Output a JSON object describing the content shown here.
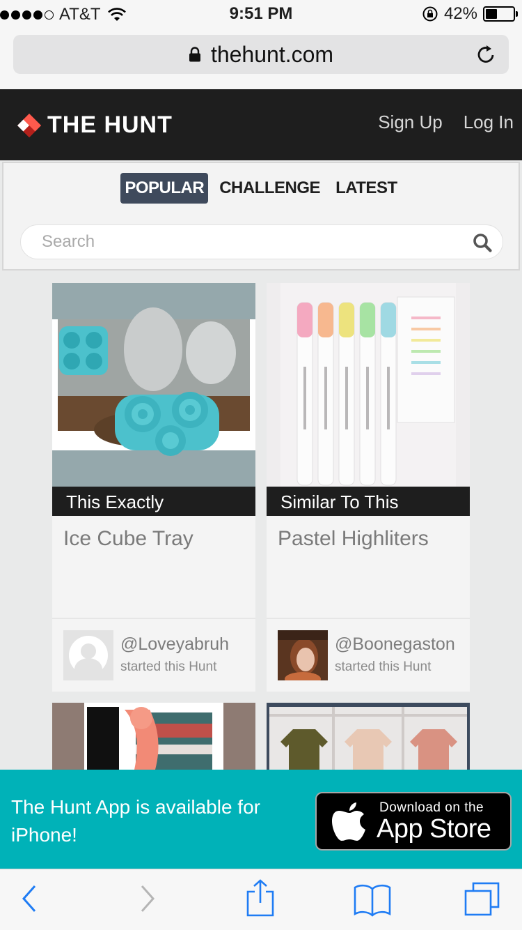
{
  "status_bar": {
    "carrier": "AT&T",
    "time": "9:51 PM",
    "battery_percent": "42%",
    "battery_level": 0.42,
    "signal_bars": 4,
    "signal_max": 5
  },
  "browser": {
    "url": "thehunt.com"
  },
  "header": {
    "logo_text": "THE HUNT",
    "sign_up": "Sign Up",
    "log_in": "Log In"
  },
  "tabs": [
    {
      "label": "POPULAR",
      "active": true
    },
    {
      "label": "CHALLENGE",
      "active": false
    },
    {
      "label": "LATEST",
      "active": false
    }
  ],
  "search": {
    "placeholder": "Search",
    "value": ""
  },
  "cards": [
    {
      "label": "This Exactly",
      "title": "Ice Cube Tray",
      "user": "@Loveyabruh",
      "sub": "started this Hunt"
    },
    {
      "label": "Similar To This",
      "title": "Pastel Highliters",
      "user": "@Boonegaston",
      "sub": "started this Hunt"
    }
  ],
  "banner": {
    "text": "The Hunt App is available for iPhone!",
    "badge_small": "Download on the",
    "badge_big": "App Store"
  },
  "colors": {
    "header_bg": "#1e1e1e",
    "accent_red": "#e8362f",
    "active_tab": "#3f4a5c",
    "banner_bg": "#00b2b8",
    "ios_blue": "#1f7cf4"
  },
  "icons": {
    "lock": "lock-icon",
    "reload": "reload-icon",
    "search": "search-icon",
    "back": "back-chevron-icon",
    "forward": "forward-chevron-icon",
    "share": "share-icon",
    "bookmarks": "bookmarks-icon",
    "tabs": "tabs-icon",
    "apple": "apple-icon"
  }
}
